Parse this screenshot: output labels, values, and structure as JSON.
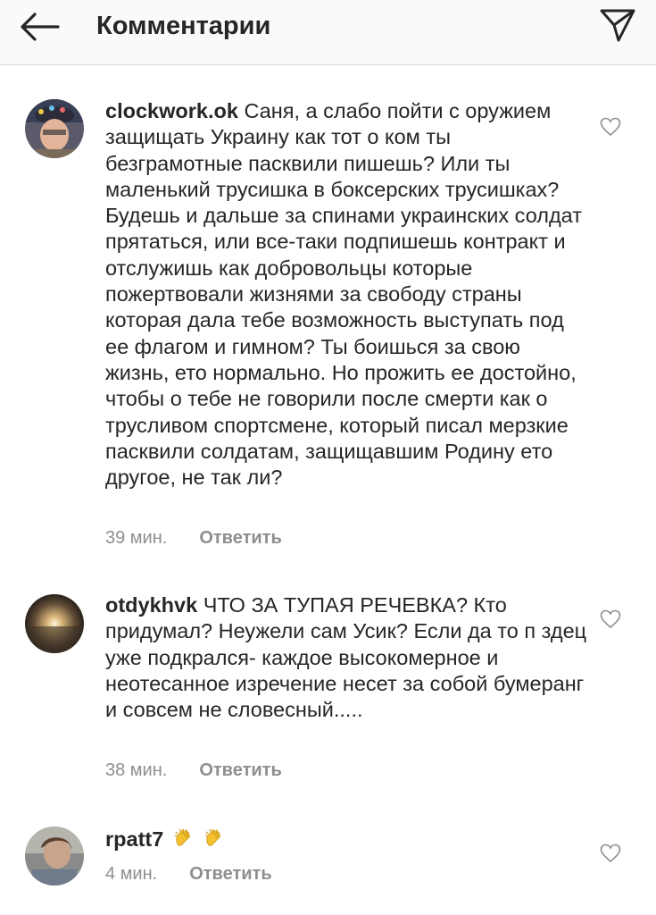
{
  "header": {
    "title": "Комментарии",
    "back_icon": "arrow-left-icon",
    "send_icon": "paper-plane-icon"
  },
  "comments": [
    {
      "username": "clockwork.ok",
      "text": "Саня, а слабо пойти с оружием защищать Украину как тот о ком ты безграмотные пасквили пишешь? Или ты маленький трусишка в боксерских трусишках? Будешь и дальше за спинами украинских солдат прятаться, или все-таки подпишешь контракт и отслужишь как добровольцы которые пожертвовали жизнями за свободу страны которая дала тебе возможность выступать под ее флагом и гимном? Ты боишься за свою жизнь, ето нормально. Но прожить ее достойно, чтобы о тебе не говорили после смерти как о трусливом спортсмене, который писал мерзкие пасквили солдатам, защищавшим Родину ето другое, не так ли?",
      "time": "39 мин.",
      "reply_label": "Ответить"
    },
    {
      "username": "otdykhvk",
      "text": "ЧТО ЗА ТУПАЯ РЕЧЕВКА? Кто придумал? Неужели сам Усик? Если да то п   здец уже подкрался- каждое высокомерное и неотесанное изречение несет за собой бумеранг и совсем не словесный.....",
      "time": "38 мин.",
      "reply_label": "Ответить"
    },
    {
      "username": "rpatt7",
      "text": "",
      "emoji": [
        "clapping-hands-emoji",
        "clapping-hands-emoji"
      ],
      "time": "4 мин.",
      "reply_label": "Ответить"
    }
  ],
  "colors": {
    "text": "#262626",
    "secondary": "#8e8e8e",
    "divider": "#dbdbdb",
    "header_bg": "#fafafa"
  }
}
